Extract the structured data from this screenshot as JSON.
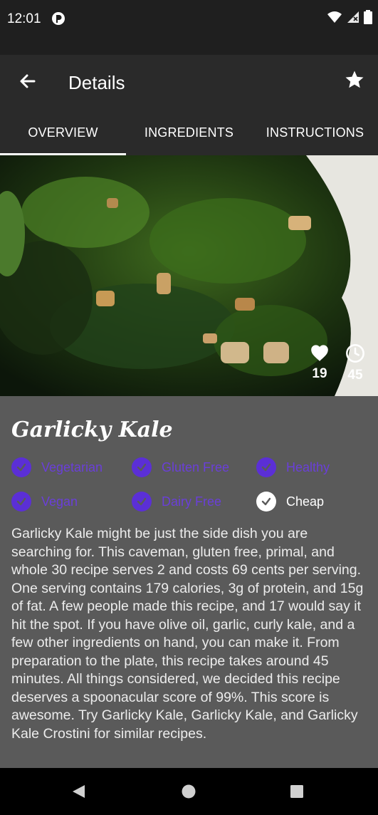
{
  "status": {
    "time": "12:01"
  },
  "appbar": {
    "title": "Details"
  },
  "tabs": [
    {
      "label": "OVERVIEW"
    },
    {
      "label": "INGREDIENTS"
    },
    {
      "label": "INSTRUCTIONS"
    }
  ],
  "hero": {
    "likes": "19",
    "minutes": "45"
  },
  "recipe": {
    "title": "Garlicky Kale",
    "tags": [
      {
        "label": "Vegetarian",
        "active": true
      },
      {
        "label": "Gluten Free",
        "active": true
      },
      {
        "label": "Healthy",
        "active": true
      },
      {
        "label": "Vegan",
        "active": true
      },
      {
        "label": "Dairy Free",
        "active": true
      },
      {
        "label": "Cheap",
        "active": false
      }
    ],
    "summary": "Garlicky Kale might be just the side dish you are searching for. This caveman, gluten free, primal, and whole 30 recipe serves 2 and costs 69 cents per serving. One serving contains 179 calories, 3g of protein, and 15g of fat. A few people made this recipe, and 17 would say it hit the spot. If you have olive oil, garlic, curly kale, and a few other ingredients on hand, you can make it. From preparation to the plate, this recipe takes around 45 minutes. All things considered, we decided this recipe deserves a spoonacular score of 99%. This score is awesome. Try Garlicky Kale, Garlicky Kale, and Garlicky Kale Crostini for similar recipes."
  },
  "colors": {
    "accent": "#5b2fd6",
    "appbar": "#2a2a2a",
    "content_bg": "#5a5a5a"
  }
}
